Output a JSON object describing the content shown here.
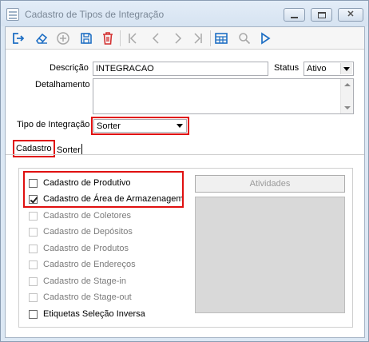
{
  "window": {
    "title": "Cadastro de Tipos de Integração",
    "controls": {
      "minimize": "minimize",
      "maximize": "maximize",
      "close": "✕"
    }
  },
  "toolbar": {
    "buttons": [
      "exit-icon",
      "eraser-icon",
      "add-icon",
      "save-icon",
      "delete-icon",
      "first-icon",
      "previous-icon",
      "next-icon",
      "last-icon",
      "grid-icon",
      "search-icon",
      "play-icon"
    ]
  },
  "form": {
    "descricao_label": "Descrição",
    "descricao_value": "INTEGRACAO",
    "status_label": "Status",
    "status_value": "Ativo",
    "detalhamento_label": "Detalhamento",
    "detalhamento_value": "",
    "tipo_label": "Tipo de Integração",
    "tipo_value": "Sorter"
  },
  "tabs": [
    {
      "label": "Cadastro",
      "active": true
    },
    {
      "label": "Sorter",
      "active": false
    }
  ],
  "checkboxes": [
    {
      "label": "Cadastro de Produtivo",
      "checked": false,
      "enabled": true
    },
    {
      "label": "Cadastro de Área de Armazenagem",
      "checked": true,
      "enabled": true
    },
    {
      "label": "Cadastro de Coletores",
      "checked": false,
      "enabled": false
    },
    {
      "label": "Cadastro de Depósitos",
      "checked": false,
      "enabled": false
    },
    {
      "label": "Cadastro de Produtos",
      "checked": false,
      "enabled": false
    },
    {
      "label": "Cadastro de Endereços",
      "checked": false,
      "enabled": false
    },
    {
      "label": "Cadastro de Stage-in",
      "checked": false,
      "enabled": false
    },
    {
      "label": "Cadastro de Stage-out",
      "checked": false,
      "enabled": false
    },
    {
      "label": "Etiquetas Seleção Inversa",
      "checked": false,
      "enabled": true
    }
  ],
  "atividades_button": "Atividades",
  "colors": {
    "highlight_border": "#e01010",
    "toolbar_icon_blue": "#1f6fc4",
    "toolbar_icon_red": "#d43030",
    "disabled_text": "#7b7b7b"
  }
}
